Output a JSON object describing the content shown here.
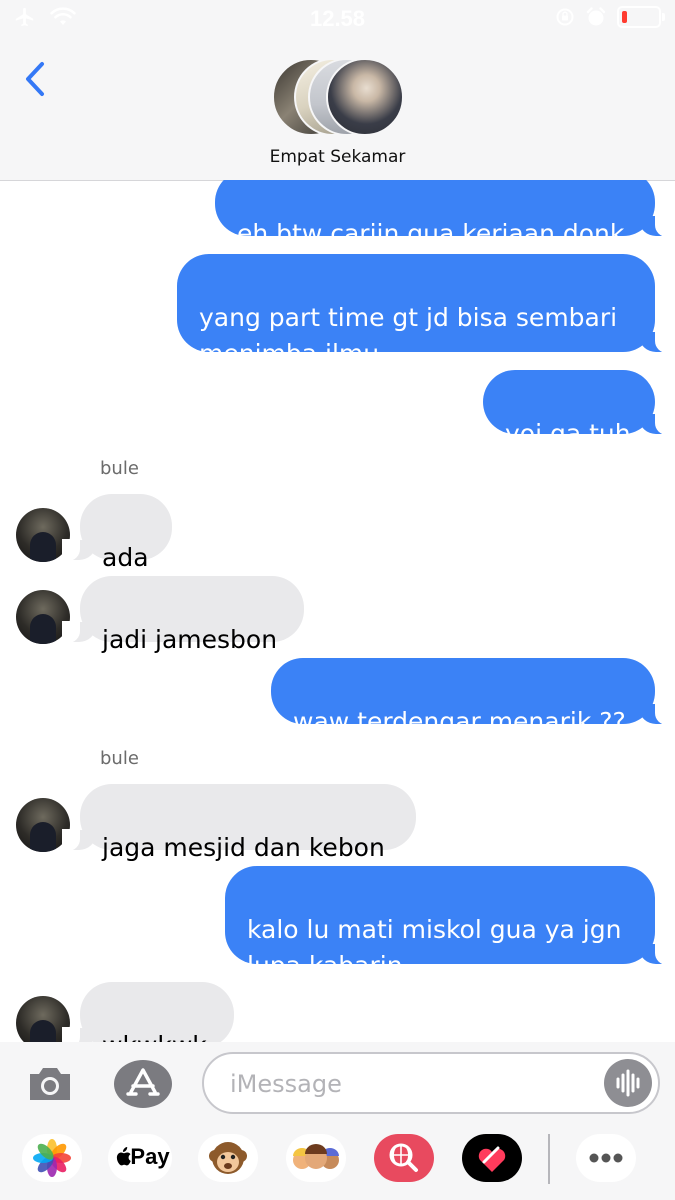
{
  "status_bar": {
    "time": "12.58",
    "left_icons": [
      "airplane-icon",
      "wifi-icon"
    ],
    "right_icons": [
      "orientation-lock-icon",
      "alarm-icon",
      "battery-icon"
    ],
    "battery_level": 0.08
  },
  "header": {
    "group_name": "Empat Sekamar",
    "back_icon": "chevron-left-icon"
  },
  "messages": [
    {
      "id": "m1",
      "side": "sent",
      "text": "eh btw cariin gua kerjaan donk"
    },
    {
      "id": "m2",
      "side": "sent",
      "text": "yang part time gt jd bisa sembari\nmenimba ilmu"
    },
    {
      "id": "m3",
      "side": "sent",
      "text": "yoi ga tuh"
    },
    {
      "id": "m4",
      "side": "received",
      "sender": "bule",
      "text": "ada"
    },
    {
      "id": "m5",
      "side": "received",
      "text": "jadi jamesbon"
    },
    {
      "id": "m6",
      "side": "sent",
      "text": "waw terdengar menarik ??"
    },
    {
      "id": "m7",
      "side": "received",
      "sender": "bule",
      "text": "jaga mesjid dan kebon"
    },
    {
      "id": "m8",
      "side": "sent",
      "text": "kalo lu mati miskol gua ya jgn\nlupa kabarin"
    },
    {
      "id": "m9",
      "side": "received",
      "text": "wkwkwk"
    }
  ],
  "input_bar": {
    "placeholder": "iMessage",
    "camera_icon": "camera-icon",
    "appstore_icon": "app-store-icon",
    "audio_icon": "waveform-icon"
  },
  "app_drawer": {
    "apps": [
      "photos-icon",
      "apple-pay",
      "animoji-icon",
      "memoji-icon",
      "web-search-icon",
      "digital-touch-icon",
      "more-icon"
    ],
    "apple_pay_label": "Pay"
  },
  "colors": {
    "sent_bubble": "#3b82f6",
    "received_bubble": "#e9e9eb",
    "header_bg": "#f6f6f7",
    "back_chevron": "#3478f6"
  }
}
